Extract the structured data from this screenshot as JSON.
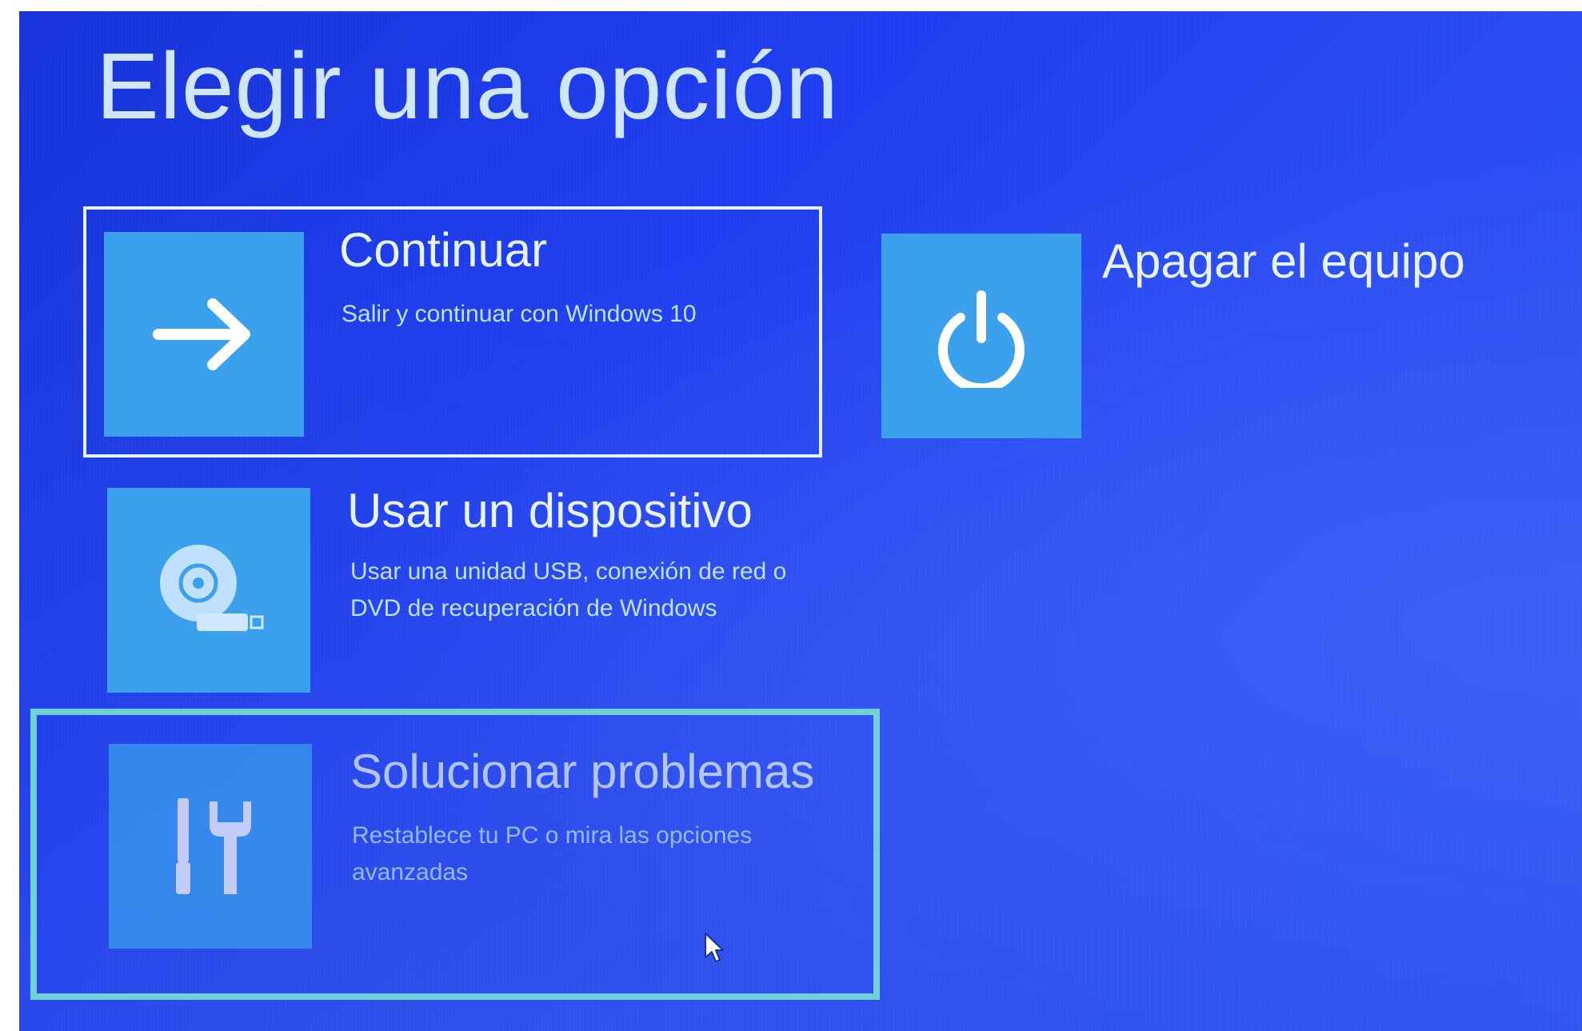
{
  "page": {
    "title": "Elegir una opción"
  },
  "options": [
    {
      "id": "continue",
      "title": "Continuar",
      "description": "Salir y continuar con Windows 10",
      "icon": "arrow-right-icon"
    },
    {
      "id": "use-device",
      "title": "Usar un dispositivo",
      "description": "Usar una unidad USB, conexión de red o DVD de recuperación de Windows",
      "icon": "disc-drive-icon"
    },
    {
      "id": "troubleshoot",
      "title": "Solucionar problemas",
      "description": "Restablece tu PC o mira las opciones avanzadas",
      "icon": "tools-icon"
    },
    {
      "id": "shutdown",
      "title": "Apagar el equipo",
      "description": "",
      "icon": "power-icon"
    }
  ],
  "colors": {
    "background": "#1f3ef0",
    "tile": "#3aa0ee",
    "highlight_frame": "#6fd0d8",
    "text": "#e6f2ff"
  }
}
